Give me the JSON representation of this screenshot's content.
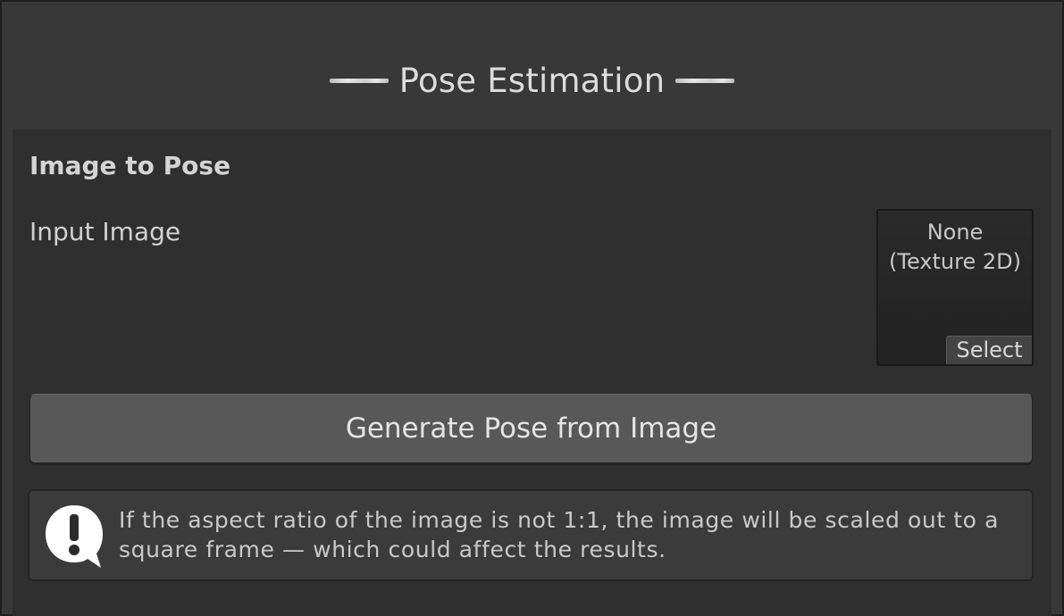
{
  "header": {
    "title": "Pose Estimation"
  },
  "section": {
    "title": "Image to Pose",
    "input_image": {
      "label": "Input Image",
      "value_line1": "None",
      "value_line2": "(Texture 2D)",
      "select_label": "Select"
    },
    "generate_button_label": "Generate Pose from Image",
    "help": {
      "icon": "exclamation-speech-bubble-icon",
      "text": "If the aspect ratio of the image is not 1:1, the image will be scaled out to a square frame — which could affect the results."
    }
  }
}
